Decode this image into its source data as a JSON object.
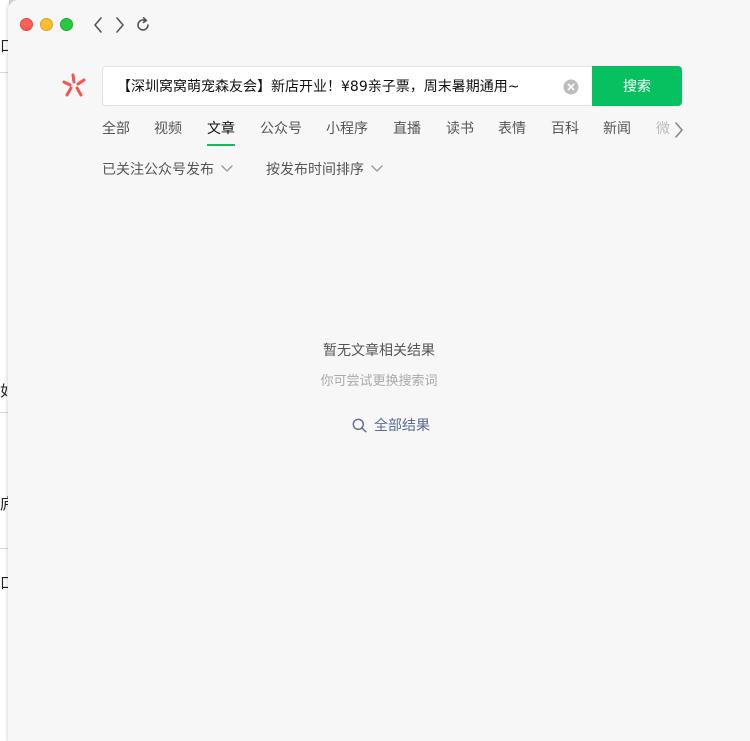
{
  "background_window": {
    "glyphs": [
      "口",
      "如",
      "庐",
      "口"
    ]
  },
  "titlebar": {
    "controls": [
      "close",
      "minimize",
      "zoom"
    ],
    "nav_icons": [
      "chevron-left-icon",
      "chevron-right-icon",
      "refresh-icon"
    ]
  },
  "search": {
    "value": "【深圳窝窝萌宠森友会】新店开业！¥89亲子票，周末暑期通用~",
    "button_label": "搜索"
  },
  "tabs": [
    {
      "label": "全部",
      "active": false
    },
    {
      "label": "视频",
      "active": false
    },
    {
      "label": "文章",
      "active": true
    },
    {
      "label": "公众号",
      "active": false
    },
    {
      "label": "小程序",
      "active": false
    },
    {
      "label": "直播",
      "active": false
    },
    {
      "label": "读书",
      "active": false
    },
    {
      "label": "表情",
      "active": false
    },
    {
      "label": "百科",
      "active": false
    },
    {
      "label": "新闻",
      "active": false
    },
    {
      "label": "微",
      "active": false
    }
  ],
  "filters": [
    {
      "label": "已关注公众号发布"
    },
    {
      "label": "按发布时间排序"
    }
  ],
  "empty_state": {
    "title": "暂无文章相关结果",
    "subtitle": "你可尝试更换搜索词",
    "link_label": "全部结果"
  },
  "colors": {
    "accent": "#07c160",
    "link": "#576b95",
    "logo": "#fa5151"
  }
}
